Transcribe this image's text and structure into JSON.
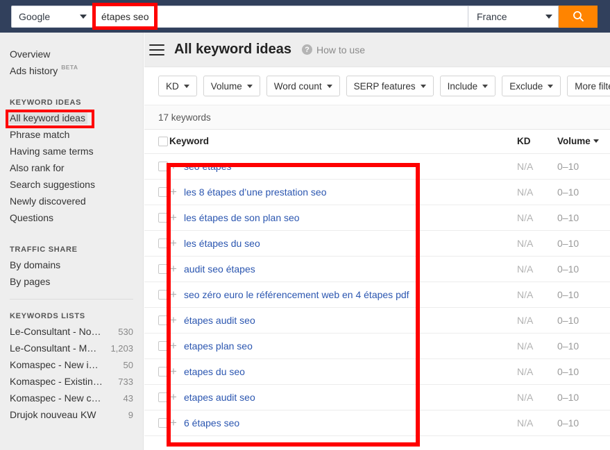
{
  "topbar": {
    "engine_select": {
      "value": "Google",
      "icon": "chevron-down-icon"
    },
    "query_input": {
      "value": "étapes seo",
      "placeholder": ""
    },
    "country_select": {
      "value": "France",
      "icon": "chevron-down-icon"
    },
    "search_button": {
      "icon": "search-icon",
      "label": "Search",
      "color": "#ff8400"
    }
  },
  "sidebar": {
    "top_items": [
      {
        "label": "Overview",
        "badge": ""
      },
      {
        "label": "Ads history",
        "badge": "BETA"
      }
    ],
    "groups": [
      {
        "title": "KEYWORD IDEAS",
        "items": [
          {
            "label": "All keyword ideas",
            "selected": true
          },
          {
            "label": "Phrase match",
            "selected": false
          },
          {
            "label": "Having same terms",
            "selected": false
          },
          {
            "label": "Also rank for",
            "selected": false
          },
          {
            "label": "Search suggestions",
            "selected": false
          },
          {
            "label": "Newly discovered",
            "selected": false
          },
          {
            "label": "Questions",
            "selected": false
          }
        ]
      },
      {
        "title": "TRAFFIC SHARE",
        "items": [
          {
            "label": "By domains",
            "selected": false
          },
          {
            "label": "By pages",
            "selected": false
          }
        ]
      }
    ],
    "keywords_lists": {
      "title": "KEYWORDS LISTS",
      "rows": [
        {
          "name": "Le-Consultant - No…",
          "count": "530"
        },
        {
          "name": "Le-Consultant - M…",
          "count": "1,203"
        },
        {
          "name": "Komaspec - New i…",
          "count": "50"
        },
        {
          "name": "Komaspec - Existin…",
          "count": "733"
        },
        {
          "name": "Komaspec - New c…",
          "count": "43"
        },
        {
          "name": "Drujok nouveau KW",
          "count": "9"
        }
      ]
    }
  },
  "main": {
    "menu_icon": "hamburger-icon",
    "title": "All keyword ideas",
    "how_to_use": {
      "label": "How to use",
      "icon": "question-mark-icon"
    },
    "filters": [
      {
        "label": "KD"
      },
      {
        "label": "Volume"
      },
      {
        "label": "Word count"
      },
      {
        "label": "SERP features"
      },
      {
        "label": "Include"
      },
      {
        "label": "Exclude"
      },
      {
        "label": "More filters"
      }
    ],
    "result_count": "17 keywords",
    "table": {
      "columns": [
        "Keyword",
        "KD",
        "Volume"
      ],
      "sorted_column": "Volume",
      "rows": [
        {
          "keyword": "seo étapes",
          "kd": "N/A",
          "volume": "0–10"
        },
        {
          "keyword": "les 8 étapes d’une prestation seo",
          "kd": "N/A",
          "volume": "0–10"
        },
        {
          "keyword": "les étapes de son plan seo",
          "kd": "N/A",
          "volume": "0–10"
        },
        {
          "keyword": "les étapes du seo",
          "kd": "N/A",
          "volume": "0–10"
        },
        {
          "keyword": "audit seo étapes",
          "kd": "N/A",
          "volume": "0–10"
        },
        {
          "keyword": "seo zéro euro le référencement web en 4 étapes pdf",
          "kd": "N/A",
          "volume": "0–10"
        },
        {
          "keyword": "étapes audit seo",
          "kd": "N/A",
          "volume": "0–10"
        },
        {
          "keyword": "etapes plan seo",
          "kd": "N/A",
          "volume": "0–10"
        },
        {
          "keyword": "etapes du seo",
          "kd": "N/A",
          "volume": "0–10"
        },
        {
          "keyword": "etapes audit seo",
          "kd": "N/A",
          "volume": "0–10"
        },
        {
          "keyword": "6 étapes seo",
          "kd": "N/A",
          "volume": "0–10"
        }
      ]
    }
  },
  "annotations": {
    "highlight_color": "#ff0000",
    "boxes": [
      "query-input",
      "sidebar-all-keyword-ideas",
      "keyword-column"
    ]
  }
}
